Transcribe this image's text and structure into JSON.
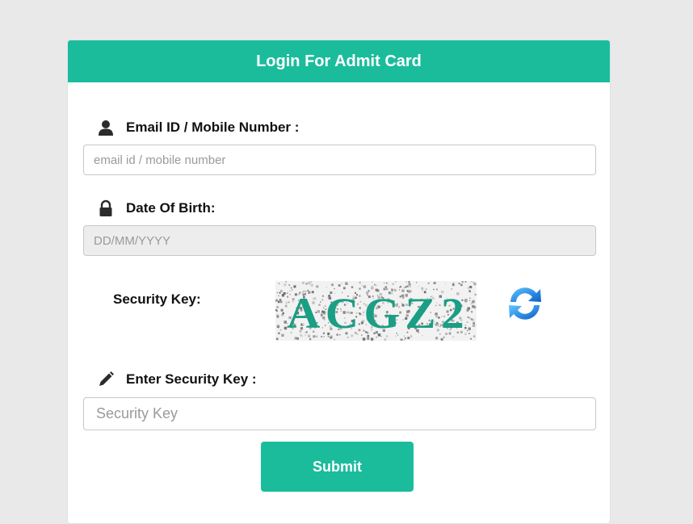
{
  "header": {
    "title": "Login For Admit Card"
  },
  "email": {
    "label": "Email ID / Mobile Number :",
    "placeholder": "email id / mobile number",
    "icon": "user-icon"
  },
  "dob": {
    "label": "Date Of Birth:",
    "placeholder": "DD/MM/YYYY",
    "icon": "lock-icon"
  },
  "security": {
    "label": "Security Key:",
    "captcha_text": "ACGZ2",
    "refresh_icon": "refresh-icon"
  },
  "enter_key": {
    "label": "Enter Security Key :",
    "placeholder": "Security Key",
    "icon": "pencil-icon"
  },
  "submit": {
    "label": "Submit"
  },
  "colors": {
    "accent": "#1abc9c",
    "background": "#e9e9e9",
    "refresh": "#1e88e5"
  }
}
